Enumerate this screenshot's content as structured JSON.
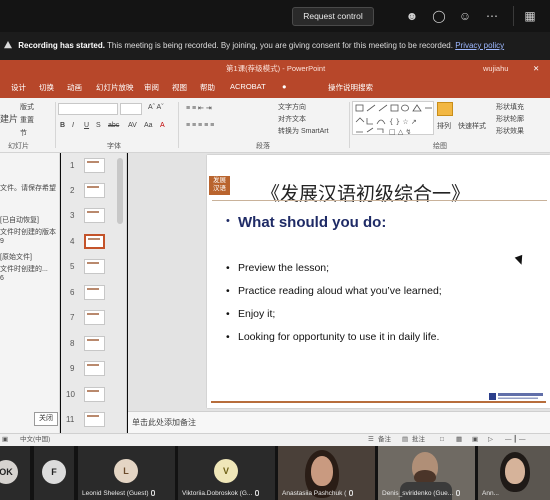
{
  "meeting": {
    "request_control": "Request control",
    "recording_label": "Recording has started.",
    "recording_text": "This meeting is being recorded. By joining, you are giving consent for this meeting to be recorded.",
    "privacy_link": "Privacy policy"
  },
  "app": {
    "title": "第1课(荐级模式) - PowerPoint",
    "user": "wujiahu",
    "menu": [
      "设计",
      "切换",
      "动画",
      "幻灯片放映",
      "审阅",
      "视图",
      "帮助",
      "ACROBAT",
      "操作说明搜索"
    ]
  },
  "ribbon": {
    "layout": "版式",
    "reset": "重置",
    "section": "节",
    "new_slide": "建片",
    "group_slides": "幻灯片",
    "group_font": "字体",
    "group_paragraph": "段落",
    "group_drawing": "绘图",
    "text_direction": "文字方向",
    "align_text": "对齐文本",
    "smartart": "转换为 SmartArt",
    "arrange": "排列",
    "quick_styles": "快速样式",
    "shape_fill": "形状填充",
    "shape_outline": "形状轮廓",
    "shape_effects": "形状效果"
  },
  "left_pane": {
    "line1": "文件。请保存希望",
    "line2": "[已自动恢复]",
    "line3": "文件时创建的版本",
    "line4": "9",
    "line5": "[原始文件]",
    "line6": "文件时创建的...",
    "line7": "6",
    "close": "关闭"
  },
  "thumbnails": [
    "1",
    "2",
    "3",
    "4",
    "5",
    "6",
    "7",
    "8",
    "9",
    "10",
    "11"
  ],
  "active_slide": "4",
  "slide": {
    "logo_line1": "发展",
    "logo_line2": "汉语",
    "title": "《发展汉语初级综合一》",
    "heading": "What should you do:",
    "bullets": [
      "Preview the lesson;",
      "Practice reading aloud what you’ve learned;",
      "Enjoy it;",
      "Looking for opportunity to use it in daily life."
    ]
  },
  "notes_placeholder": "单击此处添加备注",
  "status": {
    "language": "中文(中国)",
    "notes": "备注",
    "comments": "批注"
  },
  "participants": [
    {
      "initials": "OK",
      "name": ""
    },
    {
      "initials": "F",
      "name": ""
    },
    {
      "initials": "L",
      "name": "Leonid Shelest (Guest)"
    },
    {
      "initials": "V",
      "name": "Viktoriia.Dobroskok (G..."
    },
    {
      "initials": "",
      "name": "Anastasiia Pashchuk ("
    },
    {
      "initials": "",
      "name": "Denis_sviridenko (Gue..."
    },
    {
      "initials": "",
      "name": "Ann..."
    }
  ],
  "colors": {
    "ppt_accent": "#b7472a",
    "heading_navy": "#1f2b66",
    "rule_brown": "#b76d3b"
  }
}
